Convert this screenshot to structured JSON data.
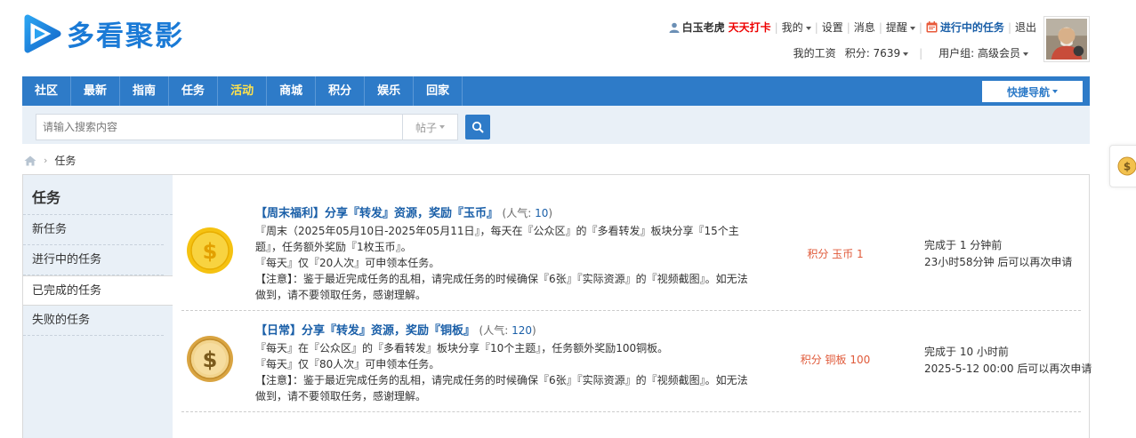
{
  "logo": {
    "text": "多看聚影"
  },
  "user_bar": {
    "username": "白玉老虎",
    "checkin": "天天打卡",
    "mine": "我的",
    "settings": "设置",
    "messages": "消息",
    "reminders": "提醒",
    "tasks_in_progress": "进行中的任务",
    "logout": "退出"
  },
  "user_bar2": {
    "salary": "我的工资",
    "points": "积分: 7639",
    "user_group": "用户组: 高级会员"
  },
  "nav": {
    "items": [
      "社区",
      "最新",
      "指南",
      "任务",
      "活动",
      "商城",
      "积分",
      "娱乐",
      "回家"
    ],
    "quick_nav": "快捷导航"
  },
  "search": {
    "placeholder": "请输入搜索内容",
    "type": "帖子"
  },
  "breadcrumb": {
    "current": "任务"
  },
  "sidebar": {
    "title": "任务",
    "items": [
      "新任务",
      "进行中的任务",
      "已完成的任务",
      "失败的任务"
    ]
  },
  "tasks": [
    {
      "title": "【周末福利】分享『转发』资源，奖励『玉币』",
      "pop_label": "(人气: ",
      "pop_value": "10",
      "pop_end": ")",
      "lines": [
        "『周末（2025年05月10日-2025年05月11日』，每天在『公众区』的『多看转发』板块分享『15个主题』，任务额外奖励『1枚玉币』。",
        "『每天』仅『20人次』可申领本任务。",
        "【注意】：鉴于最近完成任务的乱相，请完成任务的时候确保『6张』『实际资源』的『视频截图』。如无法做到，请不要领取任务，感谢理解。"
      ],
      "reward": "积分 玉币 1",
      "status1": "完成于 1 分钟前",
      "status2": "23小时58分钟 后可以再次申请",
      "coin_color": "#f5c211"
    },
    {
      "title": "【日常】分享『转发』资源，奖励『铜板』",
      "pop_label": "(人气: ",
      "pop_value": "120",
      "pop_end": ")",
      "lines": [
        "『每天』在『公众区』的『多看转发』板块分享『10个主题』，任务额外奖励100铜板。",
        "『每天』仅『80人次』可申领本任务。",
        "【注意】：鉴于最近完成任务的乱相，请完成任务的时候确保『6张』『实际资源』的『视频截图』。如无法做到，请不要领取任务，感谢理解。"
      ],
      "reward": "积分 铜板 100",
      "status1": "完成于 10 小时前",
      "status2": "2025-5-12 00:00 后可以再次申请",
      "coin_color": "#e0b457"
    }
  ]
}
